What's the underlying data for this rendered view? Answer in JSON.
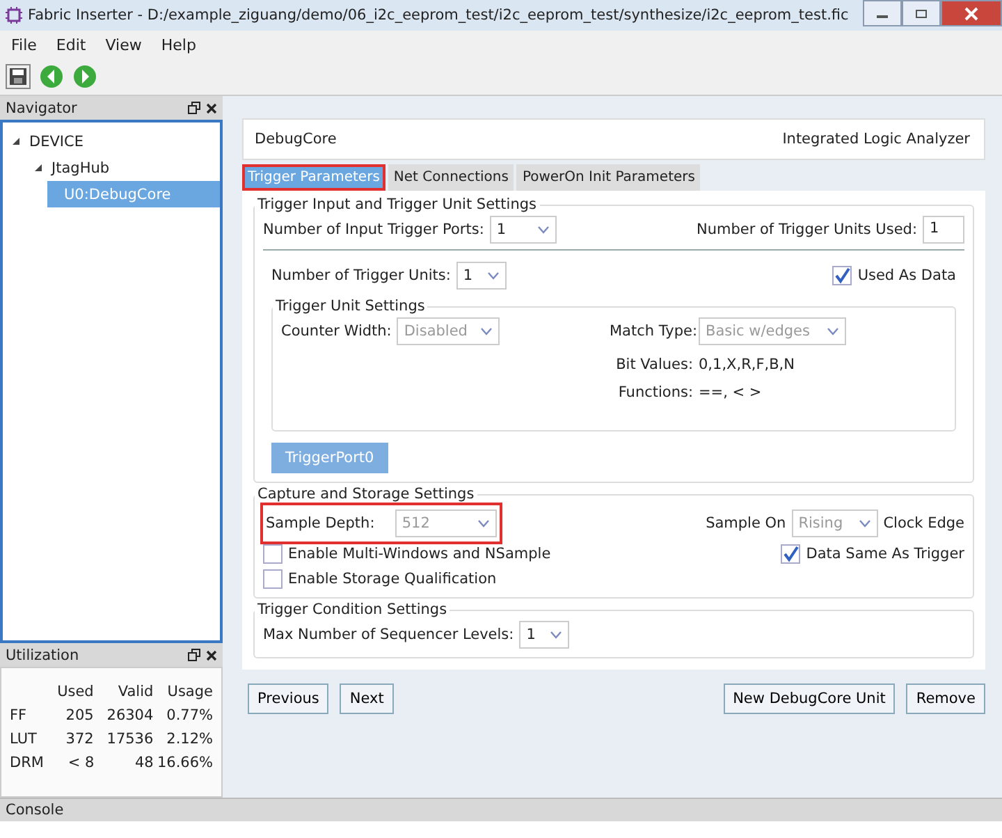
{
  "window": {
    "title": "Fabric Inserter - D:/example_ziguang/demo/06_i2c_eeprom_test/i2c_eeprom_test/synthesize/i2c_eeprom_test.fic"
  },
  "menu": [
    "File",
    "Edit",
    "View",
    "Help"
  ],
  "navigator": {
    "title": "Navigator",
    "tree": [
      {
        "label": "DEVICE",
        "expanded": true,
        "selected": false,
        "children": [
          {
            "label": "JtagHub",
            "expanded": true,
            "selected": false,
            "children": [
              {
                "label": "U0:DebugCore",
                "selected": true
              }
            ]
          }
        ]
      }
    ]
  },
  "utilization": {
    "title": "Utilization",
    "columns": [
      "Used",
      "Valid",
      "Usage"
    ],
    "rows": [
      {
        "name": "FF",
        "cells": [
          "205",
          "26304",
          "0.77%"
        ]
      },
      {
        "name": "LUT",
        "cells": [
          "372",
          "17536",
          "2.12%"
        ]
      },
      {
        "name": "DRM",
        "cells": [
          "< 8",
          "48",
          "16.66%"
        ]
      }
    ]
  },
  "header": {
    "left": "DebugCore",
    "right": "Integrated Logic Analyzer"
  },
  "tabs": [
    {
      "label": "Trigger Parameters",
      "selected": true,
      "highlighted": true
    },
    {
      "label": "Net Connections",
      "selected": false,
      "highlighted": false
    },
    {
      "label": "PowerOn Init Parameters",
      "selected": false,
      "highlighted": false
    }
  ],
  "trigger_input": {
    "title": "Trigger Input and Trigger Unit Settings",
    "ports_label": "Number of Input Trigger Ports:",
    "ports_value": "1",
    "units_used_label": "Number of Trigger Units Used:",
    "units_used_value": "1",
    "units_label": "Number of Trigger Units:",
    "units_value": "1",
    "used_as_data": {
      "label": "Used As Data",
      "checked": true
    },
    "unit_settings": {
      "title": "Trigger Unit Settings",
      "counter_label": "Counter Width:",
      "counter_value": "Disabled",
      "match_label": "Match Type:",
      "match_value": "Basic w/edges",
      "bits_label": "Bit Values:",
      "bits_value": "0,1,X,R,F,B,N",
      "functions_label": "Functions:",
      "functions_value": "==, < >"
    },
    "port_button": "TriggerPort0"
  },
  "capture": {
    "title": "Capture and Storage Settings",
    "depth_label": "Sample Depth:",
    "depth_value": "512",
    "depth_highlighted": true,
    "sample_on_label": "Sample On",
    "sample_on_value": "Rising",
    "clock_edge": "Clock Edge",
    "checks": [
      {
        "label": "Enable Multi-Windows and NSample",
        "checked": false
      },
      {
        "label": "Data Same As Trigger",
        "checked": true
      },
      {
        "label": "Enable Storage Qualification",
        "checked": false
      }
    ]
  },
  "condition": {
    "title": "Trigger Condition Settings",
    "levels_label": "Max Number of Sequencer Levels:",
    "levels_value": "1"
  },
  "buttons_left": [
    "Previous",
    "Next"
  ],
  "buttons_right": [
    "New DebugCore Unit",
    "Remove"
  ],
  "console": {
    "title": "Console"
  }
}
